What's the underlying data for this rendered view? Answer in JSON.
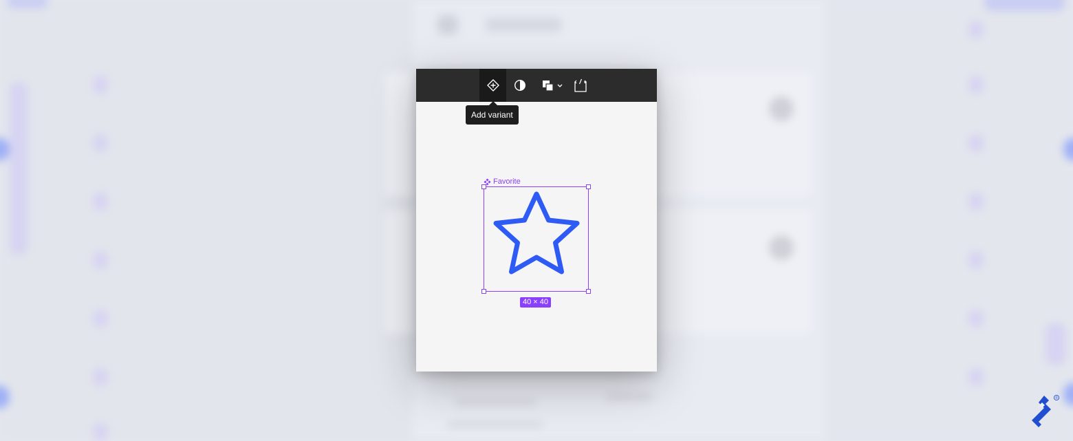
{
  "toolbar": {
    "add_variant_icon": "add-variant-icon",
    "contrast_icon": "contrast-icon",
    "fill_icon": "fill-icon",
    "code_icon": "code-icon"
  },
  "tooltip": {
    "text": "Add variant"
  },
  "component": {
    "name": "Favorite",
    "size": "40 × 40",
    "icon": "star-icon"
  },
  "colors": {
    "toolbar_bg": "#2c2c2c",
    "selection": "#8a3ffc",
    "star_stroke": "#2f5bf5",
    "canvas_bg": "#f5f5f5",
    "brand": "#204ecf"
  },
  "brand": {
    "mark": "®"
  }
}
